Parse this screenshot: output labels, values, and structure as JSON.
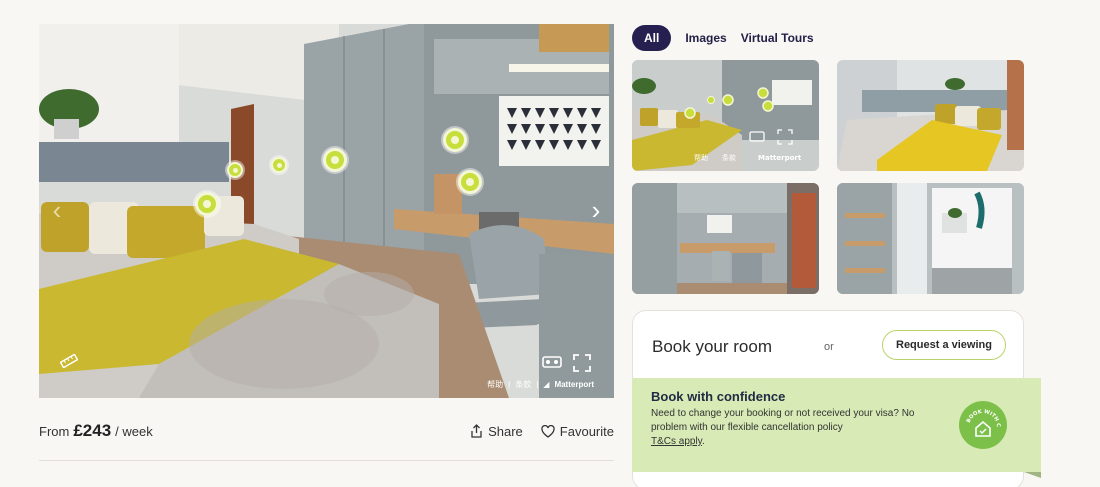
{
  "tour": {
    "footer_help": "帮助",
    "footer_terms": "条款",
    "footer_brand": "Matterport"
  },
  "price": {
    "from_label": "From",
    "amount": "£243",
    "unit": "/ week"
  },
  "actions": {
    "share": "Share",
    "favourite": "Favourite"
  },
  "tabs": [
    {
      "label": "All",
      "active": true
    },
    {
      "label": "Images",
      "active": false
    },
    {
      "label": "Virtual Tours",
      "active": false
    }
  ],
  "thumb1_footer": {
    "help": "帮助",
    "terms": "条款",
    "brand": "Matterport"
  },
  "booking": {
    "title": "Book your room",
    "or": "or",
    "request_button": "Request a viewing"
  },
  "confidence": {
    "title": "Book with confidence",
    "text": "Need to change your booking or not received your visa? No problem with our flexible cancellation policy",
    "link": "T&Cs apply",
    "link_suffix": ".",
    "badge_text": "BOOK WITH CONFIDENCE"
  },
  "colors": {
    "accent_navy": "#25204f",
    "hotspot_lime": "#c8de3c",
    "throw_yellow": "#c9b830",
    "confidence_bg": "#d8eab5",
    "badge_green": "#7cc04a"
  }
}
